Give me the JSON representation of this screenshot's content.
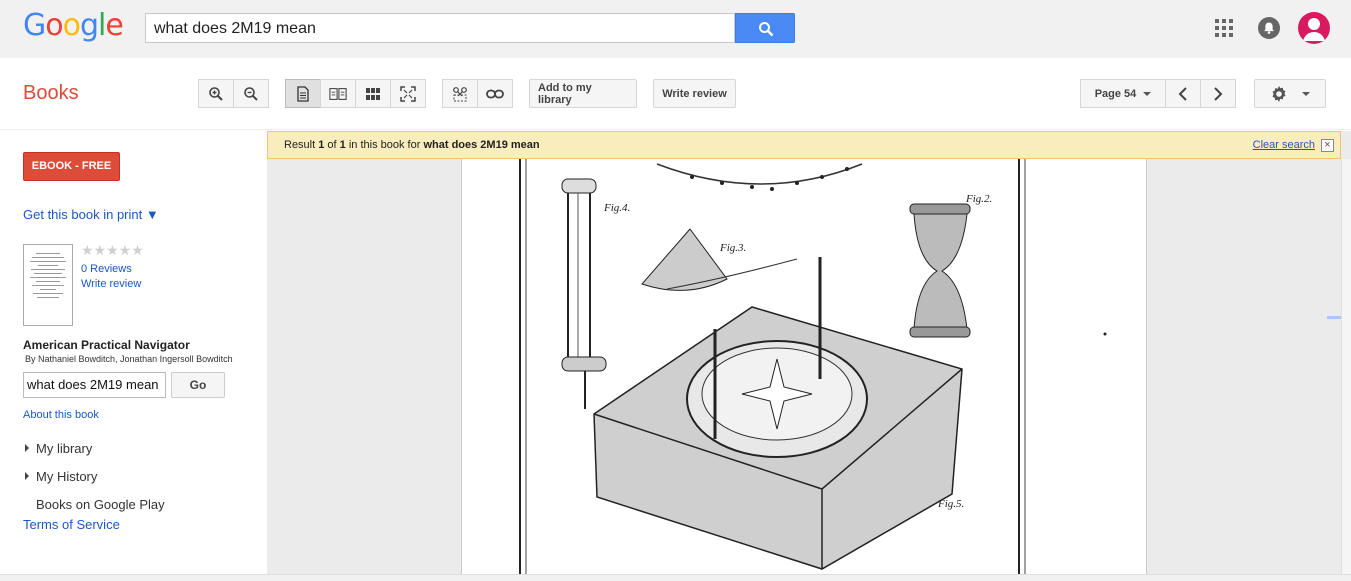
{
  "header": {
    "logo": {
      "letters": [
        "G",
        "o",
        "o",
        "g",
        "l",
        "e"
      ],
      "colors": [
        "#4285f4",
        "#ea4335",
        "#fbbc05",
        "#4285f4",
        "#34a853",
        "#ea4335"
      ]
    },
    "search_query": "what does 2M19 mean",
    "icons": [
      "search-icon",
      "apps-icon",
      "notifications-icon",
      "account-avatar"
    ]
  },
  "toolbar": {
    "section_title": "Books",
    "add_library_label": "Add to my library",
    "write_review_label": "Write review",
    "page_label": "Page 54"
  },
  "sidebar": {
    "ebook_label": "EBOOK - FREE",
    "get_print_label": "Get this book in print ▼",
    "stars": "★★★★★",
    "reviews_label": "0 Reviews",
    "write_review_label": "Write review",
    "book_title": "American Practical Navigator",
    "book_authors": "By Nathaniel Bowditch, Jonathan Ingersoll Bowditch",
    "search_in_book_value": "what does 2M19 mean",
    "go_label": "Go",
    "about_label": "About this book",
    "nav": [
      {
        "label": "My library"
      },
      {
        "label": "My History"
      },
      {
        "label": "Books on Google Play"
      }
    ],
    "tos_label": "Terms of Service"
  },
  "result_bar": {
    "prefix": "Result ",
    "current": "1",
    "of": " of ",
    "total": "1",
    "middle": " in this book for ",
    "query": "what does 2M19 mean",
    "clear_label": "Clear search"
  },
  "figure_labels": {
    "fig2": "Fig.2.",
    "fig3": "Fig.3.",
    "fig4": "Fig.4.",
    "fig5": "Fig.5."
  },
  "colors": {
    "brand_red": "#dd4b39",
    "link_blue": "#1a57c6",
    "search_blue": "#4a8af4",
    "result_bg": "#f9edbe"
  }
}
